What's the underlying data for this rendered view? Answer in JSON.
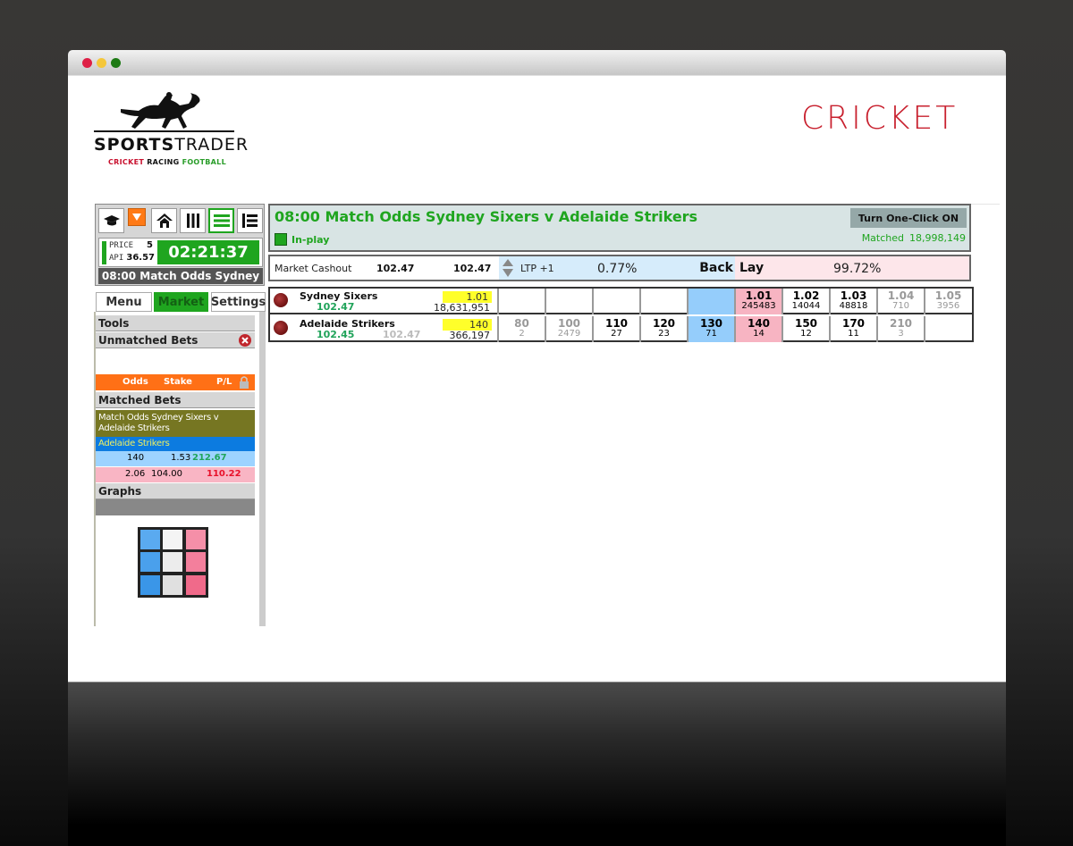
{
  "window": {
    "traffic_lights": [
      "close",
      "minimize",
      "maximize"
    ]
  },
  "brand": {
    "name_bold": "SPORTS",
    "name_light": "TRADER",
    "sub_cricket": "CRICKET",
    "sub_racing": "RACING",
    "sub_football": "FOOTBALL",
    "section_heading": "CRICKET"
  },
  "toolbar": {
    "icons": [
      "graduation-cap-icon",
      "dropdown-arrow-icon",
      "home-icon",
      "columns-icon",
      "rows-icon",
      "list-indent-icon"
    ],
    "price_label": "PRICE",
    "price_value": "5",
    "api_label": "API",
    "api_value": "36.57",
    "clock": "02:21:37",
    "market_short": "08:00 Match Odds Sydney"
  },
  "tabs": [
    {
      "label": "Menu",
      "active": false
    },
    {
      "label": "Market",
      "active": true
    },
    {
      "label": "Settings",
      "active": false
    }
  ],
  "sidebar": {
    "tools": "Tools",
    "unmatched": "Unmatched Bets",
    "columns": {
      "odds": "Odds",
      "stake": "Stake",
      "pl": "P/L"
    },
    "matched": "Matched Bets",
    "matched_market": "Match Odds Sydney Sixers v Adelaide Strikers",
    "matched_runner": "Adelaide Strikers",
    "bets": [
      {
        "type": "back",
        "odds": "140",
        "stake": "1.53",
        "pl": "212.67",
        "pl_color": "#1fa55a"
      },
      {
        "type": "lay",
        "odds": "2.06",
        "stake": "104.00",
        "pl": "110.22",
        "pl_color": "#e8102a"
      }
    ],
    "graphs": "Graphs"
  },
  "market": {
    "title": "08:00 Match Odds Sydney Sixers v Adelaide Strikers",
    "status": "In-play",
    "one_click": "Turn One-Click ON",
    "matched_label": "Matched",
    "matched_value": "18,998,149",
    "cashout_label": "Market Cashout",
    "cashout_1": "102.47",
    "cashout_2": "102.47",
    "ltp_label": "LTP +1",
    "back_pct": "0.77%",
    "back_label": "Back",
    "lay_label": "Lay",
    "lay_pct": "99.72%"
  },
  "runners": [
    {
      "name": "Sydney Sixers",
      "pl": "102.47",
      "pl_alt": "",
      "ltp": "1.01",
      "traded": "18,631,951",
      "cells": [
        {
          "p": "",
          "s": "",
          "kind": ""
        },
        {
          "p": "",
          "s": "",
          "kind": ""
        },
        {
          "p": "",
          "s": "",
          "kind": ""
        },
        {
          "p": "",
          "s": "",
          "kind": ""
        },
        {
          "p": "",
          "s": "",
          "kind": "bk"
        },
        {
          "p": "1.01",
          "s": "245483",
          "kind": "ly"
        },
        {
          "p": "1.02",
          "s": "14044",
          "kind": ""
        },
        {
          "p": "1.03",
          "s": "48818",
          "kind": ""
        },
        {
          "p": "1.04",
          "s": "710",
          "kind": "dim"
        },
        {
          "p": "1.05",
          "s": "3956",
          "kind": "dim"
        }
      ]
    },
    {
      "name": "Adelaide Strikers",
      "pl": "102.45",
      "pl_alt": "102.47",
      "ltp": "140",
      "traded": "366,197",
      "cells": [
        {
          "p": "80",
          "s": "2",
          "kind": "dim"
        },
        {
          "p": "100",
          "s": "2479",
          "kind": "dim"
        },
        {
          "p": "110",
          "s": "27",
          "kind": ""
        },
        {
          "p": "120",
          "s": "23",
          "kind": ""
        },
        {
          "p": "130",
          "s": "71",
          "kind": "bk"
        },
        {
          "p": "140",
          "s": "14",
          "kind": "ly"
        },
        {
          "p": "150",
          "s": "12",
          "kind": ""
        },
        {
          "p": "170",
          "s": "11",
          "kind": ""
        },
        {
          "p": "210",
          "s": "3",
          "kind": "dim"
        },
        {
          "p": "",
          "s": "",
          "kind": ""
        }
      ]
    }
  ]
}
